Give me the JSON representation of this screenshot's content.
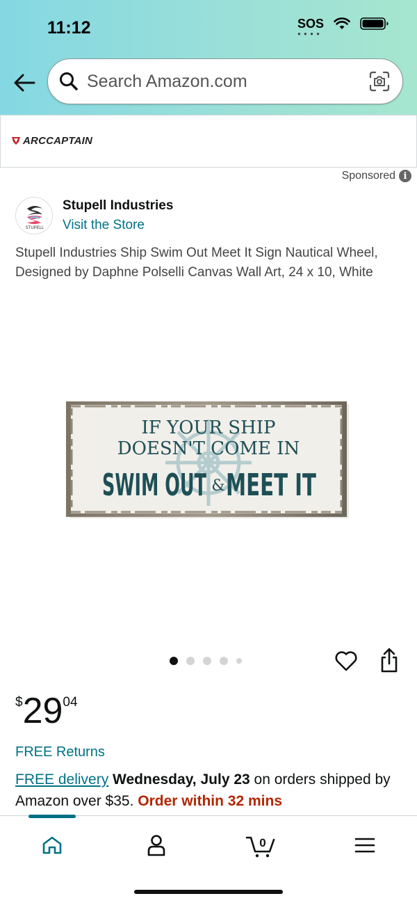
{
  "status_bar": {
    "time": "11:12",
    "sos": "SOS"
  },
  "search": {
    "placeholder": "Search Amazon.com"
  },
  "ad": {
    "brand": "ARCCAPTAIN",
    "sponsored_label": "Sponsored"
  },
  "store": {
    "logo_text": "STUPELL",
    "name": "Stupell Industries",
    "link": "Visit the Store"
  },
  "product": {
    "title": "Stupell Industries Ship Swim Out Meet It Sign Nautical Wheel, Designed by Daphne Polselli Canvas Wall Art, 24 x 10, White",
    "image_text": {
      "line1": "IF YOUR SHIP",
      "line2": "DOESN'T COME IN",
      "line3a": "SWIM OUT",
      "amp": "&",
      "line3b": "MEET IT"
    },
    "image_count": 5,
    "active_image": 1
  },
  "price": {
    "symbol": "$",
    "whole": "29",
    "fraction": "04"
  },
  "shipping": {
    "free_returns": "FREE Returns",
    "free_delivery_link": "FREE delivery",
    "delivery_date": "Wednesday, July 23",
    "delivery_condition": "on orders shipped by Amazon over $35.",
    "order_within": "Order within 32 mins"
  },
  "nav": {
    "items": [
      {
        "name": "home",
        "icon": "home-icon",
        "active": true
      },
      {
        "name": "account",
        "icon": "person-icon"
      },
      {
        "name": "cart",
        "icon": "cart-icon",
        "count": "0"
      },
      {
        "name": "menu",
        "icon": "menu-icon"
      }
    ]
  },
  "colors": {
    "link": "#007185",
    "urgent": "#b12704",
    "header_gradient_start": "#84d8e3",
    "header_gradient_end": "#a6e6cf",
    "sign_text": "#1e4f56"
  }
}
